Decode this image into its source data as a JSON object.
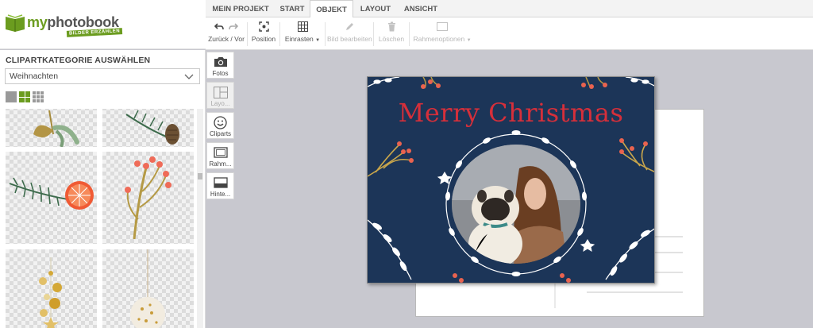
{
  "app": {
    "brand_prefix": "my",
    "brand_name": "photobook",
    "brand_tagline": "BILDER ERZÄHLEN"
  },
  "tabs": [
    {
      "label": "MEIN PROJEKT",
      "active": false
    },
    {
      "label": "START",
      "active": false
    },
    {
      "label": "OBJEKT",
      "active": true
    },
    {
      "label": "LAYOUT",
      "active": false
    },
    {
      "label": "ANSICHT",
      "active": false
    }
  ],
  "ribbon": {
    "undo_redo": "Zurück / Vor",
    "position": "Position",
    "snap": "Einrasten",
    "edit_image": "Bild bearbeiten",
    "delete": "Löschen",
    "frame_options": "Rahmenoptionen"
  },
  "left_panel": {
    "title": "CLIPARTKATEGORIE AUSWÄHLEN",
    "category_selected": "Weihnachten",
    "grid_sizes": [
      "large",
      "medium",
      "small"
    ],
    "grid_active": "medium"
  },
  "tools": [
    {
      "label": "Fotos",
      "icon": "camera-icon",
      "enabled": true
    },
    {
      "label": "Layo...",
      "icon": "layout-icon",
      "enabled": false
    },
    {
      "label": "Cliparts",
      "icon": "smiley-icon",
      "enabled": true
    },
    {
      "label": "Rahm...",
      "icon": "frame-icon",
      "enabled": true
    },
    {
      "label": "Hinte...",
      "icon": "background-icon",
      "enabled": true
    }
  ],
  "card": {
    "greeting": "Merry Christmas"
  },
  "colors": {
    "brand_green": "#6b9c1f",
    "card_navy": "#1c3558",
    "greeting_red": "#d62f3a"
  }
}
